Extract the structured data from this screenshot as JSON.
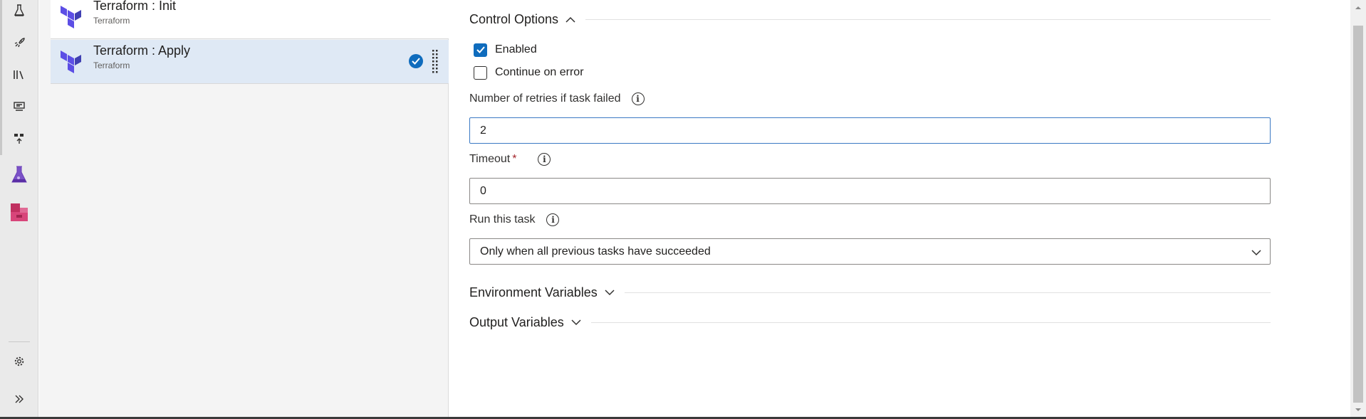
{
  "tasks": [
    {
      "name": "Terraform : Init",
      "subtitle": "Terraform",
      "selected": false
    },
    {
      "name": "Terraform : Apply",
      "subtitle": "Terraform",
      "selected": true
    }
  ],
  "rail": {
    "icons": [
      "test-plans-icon",
      "pipelines-icon",
      "library-icon",
      "deployment-groups-icon",
      "task-groups-icon",
      "test-flask-icon",
      "artifacts-icon",
      "settings-gear-icon",
      "expand-chevrons-icon"
    ]
  },
  "control_options": {
    "title": "Control Options",
    "enabled_label": "Enabled",
    "enabled_checked": true,
    "continue_on_error_label": "Continue on error",
    "continue_on_error_checked": false,
    "retries_label": "Number of retries if task failed",
    "retries_value": "2",
    "timeout_label": "Timeout",
    "timeout_required_mark": "*",
    "timeout_value": "0",
    "run_task_label": "Run this task",
    "run_task_value": "Only when all previous tasks have succeeded"
  },
  "sections": {
    "environment_variables": "Environment Variables",
    "output_variables": "Output Variables"
  },
  "colors": {
    "accent": "#0f6cbd",
    "terraform_purple": "#5c4ee5",
    "selected_row": "#dfe9f5",
    "required": "#a4262c"
  }
}
